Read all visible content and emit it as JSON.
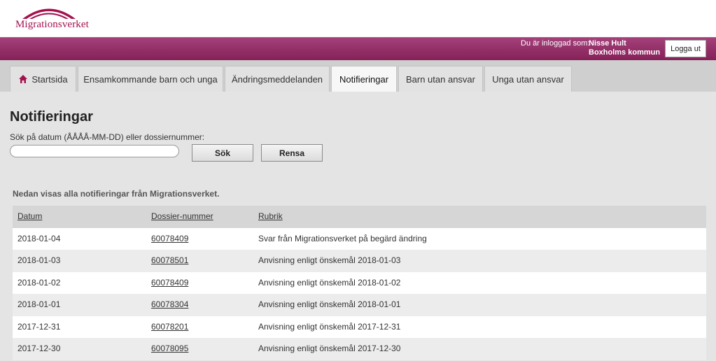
{
  "brand": {
    "logo_text": "Migrationsverket",
    "color": "#a3124f"
  },
  "user": {
    "logged_in_label": "Du är inloggad som:",
    "name": "Nisse Hult",
    "organization": "Boxholms kommun",
    "logout_label": "Logga ut"
  },
  "tabs": [
    {
      "label": "Startsida",
      "icon": "home-icon"
    },
    {
      "label": "Ensamkommande barn och unga"
    },
    {
      "label": "Ändringsmeddelanden"
    },
    {
      "label": "Notifieringar",
      "active": true
    },
    {
      "label": "Barn utan ansvar"
    },
    {
      "label": "Unga utan ansvar"
    }
  ],
  "page": {
    "title": "Notifieringar",
    "search_label": "Sök på datum (ÅÅÅÅ-MM-DD) eller dossiernummer:",
    "search_value": "",
    "search_button": "Sök",
    "clear_button": "Rensa",
    "intro": "Nedan visas alla notifieringar från Migrationsverket."
  },
  "table": {
    "headers": {
      "date": "Datum",
      "dossier": "Dossier-nummer",
      "subject": "Rubrik"
    },
    "rows": [
      {
        "date": "2018-01-04",
        "dossier": "60078409",
        "subject": "Svar från Migrationsverket på begärd ändring"
      },
      {
        "date": "2018-01-03",
        "dossier": "60078501",
        "subject": "Anvisning enligt önskemål 2018-01-03"
      },
      {
        "date": "2018-01-02",
        "dossier": "60078409",
        "subject": "Anvisning enligt önskemål 2018-01-02"
      },
      {
        "date": "2018-01-01",
        "dossier": "60078304",
        "subject": "Anvisning enligt önskemål 2018-01-01"
      },
      {
        "date": "2017-12-31",
        "dossier": "60078201",
        "subject": "Anvisning enligt önskemål 2017-12-31"
      },
      {
        "date": "2017-12-30",
        "dossier": "60078095",
        "subject": "Anvisning enligt önskemål 2017-12-30"
      }
    ]
  }
}
